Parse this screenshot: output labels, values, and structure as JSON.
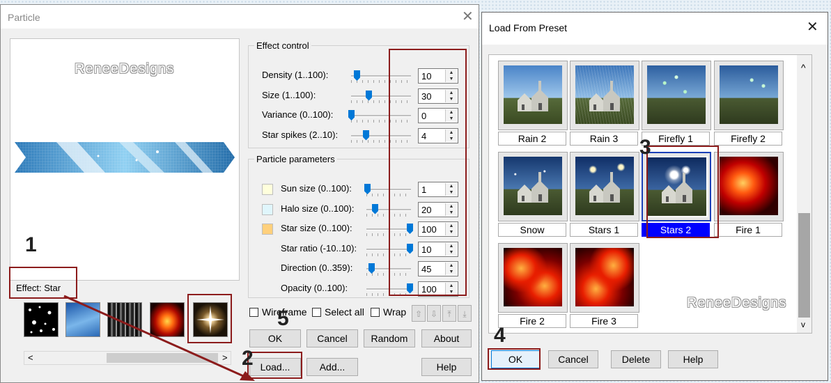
{
  "particle_dialog": {
    "title": "Particle",
    "close_glyph": "✕",
    "preview_watermark": "ReneeDesigns",
    "effect_label": "Effect: Star",
    "effect_control": {
      "title": "Effect control",
      "rows": [
        {
          "label": "Density (1..100):",
          "value": "10",
          "level_percent": 10
        },
        {
          "label": "Size (1..100):",
          "value": "30",
          "level_percent": 30
        },
        {
          "label": "Variance (0..100):",
          "value": "0",
          "level_percent": 0
        },
        {
          "label": "Star spikes (2..10):",
          "value": "4",
          "level_percent": 25
        }
      ]
    },
    "particle_parameters": {
      "title": "Particle parameters",
      "rows": [
        {
          "label": "Sun size (0..100):",
          "value": "1",
          "level_percent": 1,
          "swatch": "#ffffdc"
        },
        {
          "label": "Halo size (0..100):",
          "value": "20",
          "level_percent": 20,
          "swatch": "#e0f6fc"
        },
        {
          "label": "Star size (0..100):",
          "value": "100",
          "level_percent": 100,
          "swatch": "#ffd07c"
        },
        {
          "label": "Star ratio (-10..10):",
          "value": "10",
          "level_percent": 100
        },
        {
          "label": "Direction (0..359):",
          "value": "45",
          "level_percent": 12
        },
        {
          "label": "Opacity (0..100):",
          "value": "100",
          "level_percent": 100
        }
      ]
    },
    "checkboxes": {
      "wireframe": "Wireframe",
      "select_all": "Select all",
      "wrap": "Wrap"
    },
    "buttons": {
      "ok": "OK",
      "cancel": "Cancel",
      "random": "Random",
      "about": "About",
      "load": "Load...",
      "add": "Add...",
      "help": "Help"
    },
    "arrow_glyphs": {
      "up": "⇧",
      "down": "⇩",
      "top": "⤒",
      "bottom": "⤓"
    },
    "scroll_glyphs": {
      "left": "<",
      "right": ">"
    },
    "annotations": {
      "n1": "1",
      "n2": "2",
      "n5": "5"
    }
  },
  "preset_dialog": {
    "title": "Load From Preset",
    "close_glyph": "✕",
    "presets": [
      "Rain 2",
      "Rain 3",
      "Firefly 1",
      "Firefly 2",
      "Snow",
      "Stars 1",
      "Stars 2",
      "Fire 1",
      "Fire 2",
      "Fire 3"
    ],
    "selected": "Stars 2",
    "watermark": "ReneeDesigns",
    "buttons": {
      "ok": "OK",
      "cancel": "Cancel",
      "delete": "Delete",
      "help": "Help"
    },
    "scroll_glyphs": {
      "up": "^",
      "down": "v"
    },
    "annotations": {
      "n3": "3",
      "n4": "4"
    }
  },
  "colors": {
    "accent": "#0078d7",
    "highlight_frame": "#8c1c1c",
    "selected_bg": "#0000ff"
  }
}
